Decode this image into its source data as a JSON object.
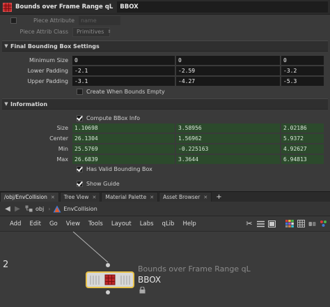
{
  "header": {
    "node_type": "Bounds over Frame Range qL",
    "node_name": "BBOX"
  },
  "piece_attribute": {
    "label": "Piece Attribute",
    "placeholder": "name"
  },
  "piece_attrib_class": {
    "label": "Piece Attrib Class",
    "value": "Primitives"
  },
  "sections": {
    "final": "Final Bounding Box Settings",
    "info": "Information"
  },
  "minimum_size": {
    "label": "Minimum Size",
    "values": [
      "0",
      "0",
      "0"
    ]
  },
  "lower_padding": {
    "label": "Lower Padding",
    "values": [
      "-2.1",
      "-2.59",
      "-3.2"
    ]
  },
  "upper_padding": {
    "label": "Upper Padding",
    "values": [
      "-3.1",
      "-4.27",
      "-5.3"
    ]
  },
  "create_when_empty": {
    "label": "Create When Bounds Empty",
    "checked": false
  },
  "compute_bbox": {
    "label": "Compute BBox Info",
    "checked": true
  },
  "info_rows": [
    {
      "label": "Size",
      "values": [
        "1.10698",
        "3.58956",
        "2.02186"
      ]
    },
    {
      "label": "Center",
      "values": [
        "26.1304",
        "1.56962",
        "5.9372"
      ]
    },
    {
      "label": "Min",
      "values": [
        "25.5769",
        "-0.225163",
        "4.92627"
      ]
    },
    {
      "label": "Max",
      "values": [
        "26.6839",
        "3.3644",
        "6.94813"
      ]
    }
  ],
  "has_valid": {
    "label": "Has Valid Bounding Box",
    "checked": true
  },
  "show_guide": {
    "label": "Show Guide",
    "checked": true
  },
  "tabs": [
    {
      "label": "/obj/EnvCollision",
      "active": true
    },
    {
      "label": "Tree View",
      "active": false
    },
    {
      "label": "Material Palette",
      "active": false
    },
    {
      "label": "Asset Browser",
      "active": false
    }
  ],
  "tab_add": "+",
  "path": {
    "obj": "obj",
    "node": "EnvCollision"
  },
  "menu": [
    "Add",
    "Edit",
    "Go",
    "View",
    "Tools",
    "Layout",
    "Labs",
    "qLib",
    "Help"
  ],
  "network": {
    "side_number": "2",
    "node_type": "Bounds over Frame Range qL",
    "node_name": "BBOX"
  },
  "colors": {
    "field_bg": "#181818",
    "info_bg": "#2c4a2c",
    "accent_red": "#c0282a",
    "node_selected": "#e8c24a"
  }
}
